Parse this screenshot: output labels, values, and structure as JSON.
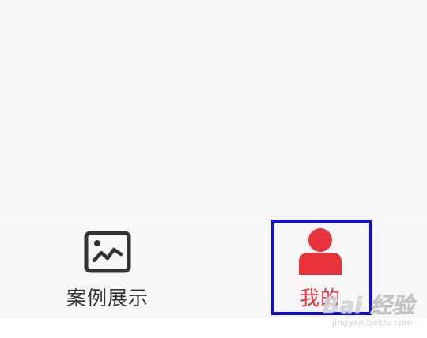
{
  "tab_bar": {
    "tabs": [
      {
        "label": "案例展示",
        "icon": "image-gallery-icon",
        "active": false
      },
      {
        "label": "我的",
        "icon": "person-icon",
        "active": true
      }
    ]
  },
  "colors": {
    "active": "#e8323c",
    "inactive": "#333333",
    "highlight": "#1010d8"
  },
  "watermark": {
    "brand": "Bai 经验",
    "url": "jingyan.baidu.com"
  }
}
